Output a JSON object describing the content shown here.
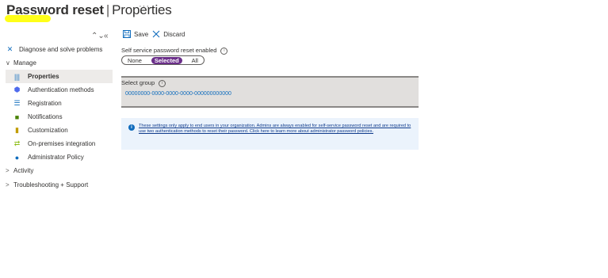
{
  "header": {
    "title_bold": "Password reset",
    "title_sep": "|",
    "title_rest": "Properties",
    "more": "···"
  },
  "sidebar": {
    "collapse_icons": [
      "⌃⌄",
      "«"
    ],
    "items": [
      {
        "label": "Diagnose and solve problems",
        "icon": "wrench-icon"
      },
      {
        "label": "Manage",
        "chevron": "∨"
      },
      {
        "label": "Properties",
        "icon": "properties-icon",
        "selected": true
      },
      {
        "label": "Authentication methods",
        "icon": "shield-icon"
      },
      {
        "label": "Registration",
        "icon": "list-icon"
      },
      {
        "label": "Notifications",
        "icon": "notification-icon"
      },
      {
        "label": "Customization",
        "icon": "bars-icon"
      },
      {
        "label": "On-premises integration",
        "icon": "sync-icon"
      },
      {
        "label": "Administrator Policy",
        "icon": "info-icon"
      },
      {
        "label": "Activity",
        "chevron": ">"
      },
      {
        "label": "Troubleshooting + Support",
        "chevron": ">"
      }
    ]
  },
  "toolbar": {
    "save_label": "Save",
    "discard_label": "Discard"
  },
  "sspr": {
    "label": "Self service password reset enabled",
    "options": [
      "None",
      "Selected",
      "All"
    ],
    "selected": "Selected"
  },
  "group": {
    "label": "Select group",
    "value": "00000000-0000-0000-0000-000000000000"
  },
  "info": {
    "text": "These settings only apply to end users in your organization. Admins are always enabled for self-service password reset and are required to use two authentication methods to reset their password. Click here to learn more about administrator password policies."
  },
  "colors": {
    "accent": "#0f6cbd",
    "toggle_selected": "#6b2f8a",
    "highlight": "#ffff00"
  }
}
